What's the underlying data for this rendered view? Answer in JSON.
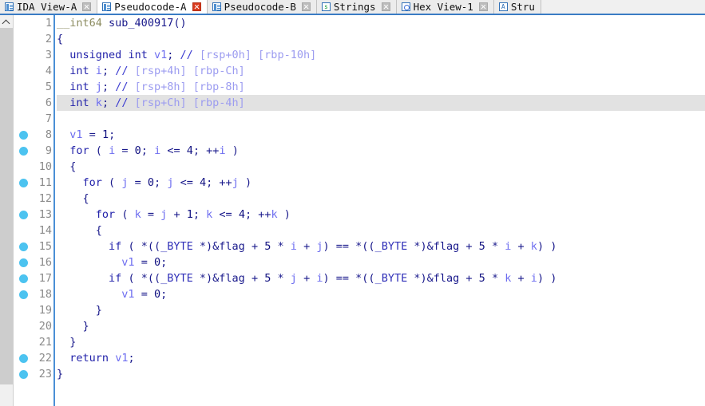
{
  "window": {
    "app": "IDA Pro",
    "view": "Pseudocode-A"
  },
  "tabs": [
    {
      "label": "IDA View-A",
      "icon": "document-icon",
      "active": false,
      "close_style": "gray"
    },
    {
      "label": "Pseudocode-A",
      "icon": "document-icon",
      "active": true,
      "close_style": "red"
    },
    {
      "label": "Pseudocode-B",
      "icon": "document-icon",
      "active": false,
      "close_style": "gray"
    },
    {
      "label": "Strings",
      "icon": "strings-icon",
      "active": false,
      "close_style": "gray"
    },
    {
      "label": "Hex View-1",
      "icon": "hex-view-icon",
      "active": false,
      "close_style": "gray"
    },
    {
      "label": "Stru",
      "icon": "structures-icon",
      "active": false,
      "close_style": "none"
    }
  ],
  "colors": {
    "accent": "#3a7cc4",
    "breakpoint_dot": "#4cc3f0",
    "keyword": "#2222aa",
    "variable": "#6e6ef0",
    "comment": "#9c9cf0",
    "current_line_highlight": "#e2e2e2"
  },
  "scrollbar": {
    "up_arrow": "scroll-up-arrow",
    "thumb_name": "vertical-scroll-thumb"
  },
  "editor": {
    "current_line": 6,
    "first_line": 1,
    "last_line": 23,
    "breakpoint_lines": [
      8,
      9,
      11,
      13,
      15,
      16,
      17,
      18,
      22,
      23
    ],
    "line_numbers": [
      1,
      2,
      3,
      4,
      5,
      6,
      7,
      8,
      9,
      10,
      11,
      12,
      13,
      14,
      15,
      16,
      17,
      18,
      19,
      20,
      21,
      22,
      23
    ],
    "lines": [
      {
        "n": 1,
        "text": "__int64 sub_400917()"
      },
      {
        "n": 2,
        "text": "{"
      },
      {
        "n": 3,
        "text": "  unsigned int v1; // [rsp+0h] [rbp-10h]"
      },
      {
        "n": 4,
        "text": "  int i; // [rsp+4h] [rbp-Ch]"
      },
      {
        "n": 5,
        "text": "  int j; // [rsp+8h] [rbp-8h]"
      },
      {
        "n": 6,
        "text": "  int k; // [rsp+Ch] [rbp-4h]"
      },
      {
        "n": 7,
        "text": ""
      },
      {
        "n": 8,
        "text": "  v1 = 1;"
      },
      {
        "n": 9,
        "text": "  for ( i = 0; i <= 4; ++i )"
      },
      {
        "n": 10,
        "text": "  {"
      },
      {
        "n": 11,
        "text": "    for ( j = 0; j <= 4; ++j )"
      },
      {
        "n": 12,
        "text": "    {"
      },
      {
        "n": 13,
        "text": "      for ( k = j + 1; k <= 4; ++k )"
      },
      {
        "n": 14,
        "text": "      {"
      },
      {
        "n": 15,
        "text": "        if ( *((_BYTE *)&flag + 5 * i + j) == *((_BYTE *)&flag + 5 * i + k) )"
      },
      {
        "n": 16,
        "text": "          v1 = 0;"
      },
      {
        "n": 17,
        "text": "        if ( *((_BYTE *)&flag + 5 * j + i) == *((_BYTE *)&flag + 5 * k + i) )"
      },
      {
        "n": 18,
        "text": "          v1 = 0;"
      },
      {
        "n": 19,
        "text": "      }"
      },
      {
        "n": 20,
        "text": "    }"
      },
      {
        "n": 21,
        "text": "  }"
      },
      {
        "n": 22,
        "text": "  return v1;"
      },
      {
        "n": 23,
        "text": "}"
      }
    ],
    "function_name": "sub_400917",
    "return_type": "__int64",
    "locals": [
      {
        "decl": "unsigned int v1",
        "rsp": "[rsp+0h]",
        "rbp": "[rbp-10h]"
      },
      {
        "decl": "int i",
        "rsp": "[rsp+4h]",
        "rbp": "[rbp-Ch]"
      },
      {
        "decl": "int j",
        "rsp": "[rsp+8h]",
        "rbp": "[rbp-8h]"
      },
      {
        "decl": "int k",
        "rsp": "[rsp+Ch]",
        "rbp": "[rbp-4h]"
      }
    ]
  }
}
